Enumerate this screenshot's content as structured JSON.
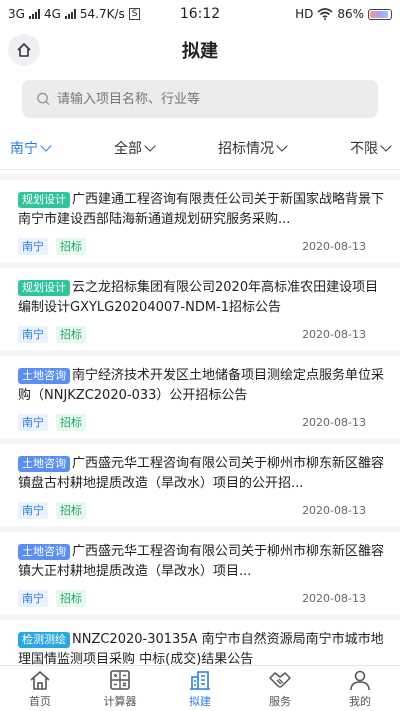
{
  "status": {
    "left": [
      "3G",
      "4G",
      "54.7K/s"
    ],
    "time": "16:12",
    "right_hd": "HD",
    "battery": "86%"
  },
  "navbar": {
    "title": "拟建"
  },
  "search": {
    "placeholder": "请输入项目名称、行业等"
  },
  "filters": [
    {
      "label": "南宁",
      "active": true
    },
    {
      "label": "全部",
      "active": false
    },
    {
      "label": "招标情况",
      "active": false
    },
    {
      "label": "不限",
      "active": false
    }
  ],
  "cards": [
    {
      "tag": "规划设计",
      "tag_color": "green",
      "title": "广西建通工程咨询有限责任公司关于新国家战略背景下南宁市建设西部陆海新通道规划研究服务采购...",
      "city": "南宁",
      "type": "招标",
      "date": "2020-08-13"
    },
    {
      "tag": "规划设计",
      "tag_color": "green",
      "title": "云之龙招标集团有限公司2020年高标准农田建设项目编制设计GXYLG20204007-NDM-1招标公告",
      "city": "南宁",
      "type": "招标",
      "date": "2020-08-13"
    },
    {
      "tag": "土地咨询",
      "tag_color": "blue",
      "title": "南宁经济技术开发区土地储备项目测绘定点服务单位采购（NNJKZC2020-033）公开招标公告",
      "city": "南宁",
      "type": "招标",
      "date": "2020-08-13"
    },
    {
      "tag": "土地咨询",
      "tag_color": "blue",
      "title": "广西盛元华工程咨询有限公司关于柳州市柳东新区雒容镇盘古村耕地提质改造（旱改水）项目的公开招...",
      "city": "南宁",
      "type": "招标",
      "date": "2020-08-13"
    },
    {
      "tag": "土地咨询",
      "tag_color": "blue",
      "title": "广西盛元华工程咨询有限公司关于柳州市柳东新区雒容镇大正村耕地提质改造（旱改水）项目...",
      "city": "南宁",
      "type": "招标",
      "date": "2020-08-13"
    },
    {
      "tag": "检测测绘",
      "tag_color": "teal",
      "title": "NNZC2020-30135A 南宁市自然资源局南宁市城市地理国情监测项目采购 中标(成交)结果公告",
      "city": "南宁",
      "type": "招标",
      "date": "2020-08-13"
    }
  ],
  "tabs": [
    {
      "label": "首页",
      "icon": "home-icon",
      "active": false
    },
    {
      "label": "计算器",
      "icon": "calculator-icon",
      "active": false
    },
    {
      "label": "拟建",
      "icon": "building-icon",
      "active": true
    },
    {
      "label": "服务",
      "icon": "handshake-icon",
      "active": false
    },
    {
      "label": "我的",
      "icon": "user-icon",
      "active": false
    }
  ],
  "colors": {
    "accent": "#2a7de1",
    "tag_green": "#2fc49a",
    "tag_blue": "#5b8ff0",
    "tag_teal": "#2aa7e0"
  }
}
